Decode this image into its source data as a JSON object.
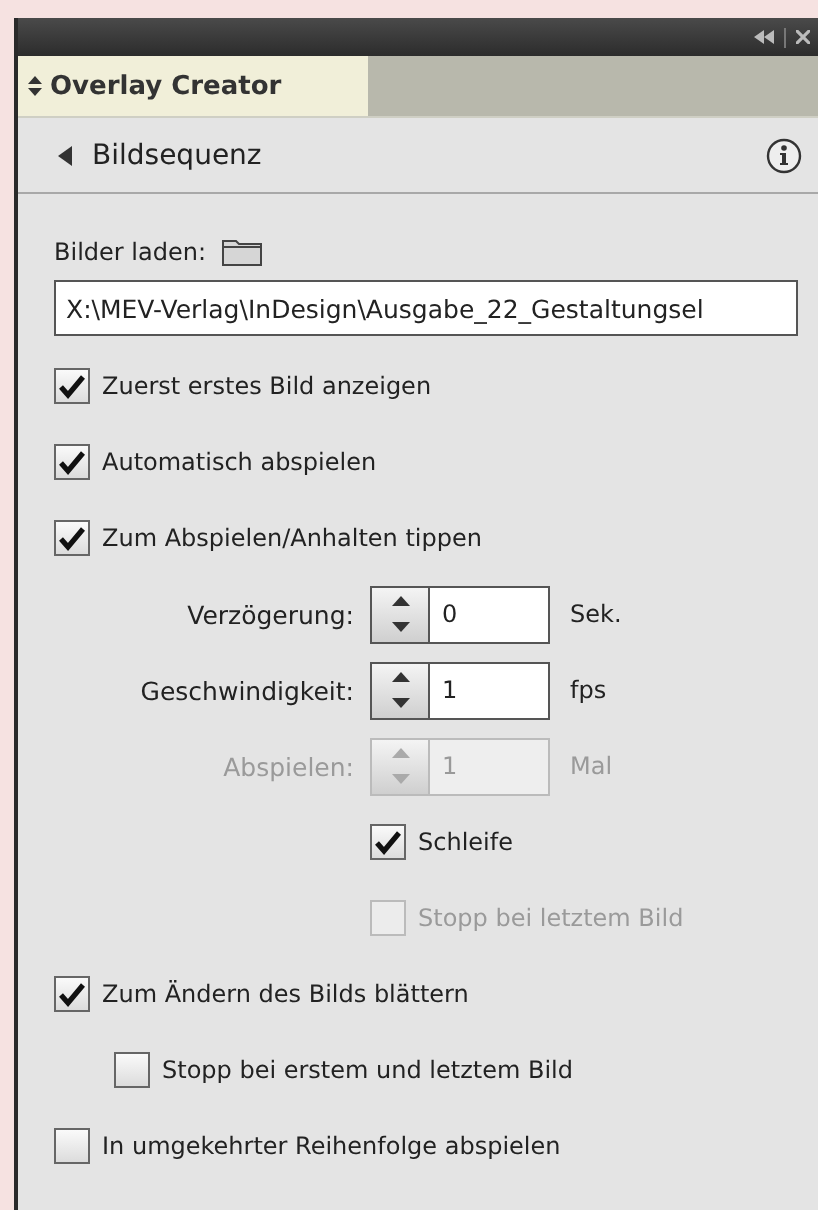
{
  "panel": {
    "tab": {
      "label": "Overlay Creator",
      "selected": true
    },
    "header": {
      "title": "Bildsequenz"
    },
    "source": {
      "label": "Bilder laden:",
      "path": "X:\\MEV-Verlag\\InDesign\\Ausgabe_22_Gestaltungsel"
    },
    "options": [
      {
        "kind": "checkbox",
        "label": "Zuerst erstes Bild anzeigen",
        "checked": true,
        "disabled": false
      },
      {
        "kind": "checkbox",
        "label": "Automatisch abspielen",
        "checked": true,
        "disabled": false
      },
      {
        "kind": "checkbox",
        "label": "Zum Abspielen/Anhalten tippen",
        "checked": true,
        "disabled": false,
        "children": [
          {
            "kind": "spinner",
            "label": "Verzögerung:",
            "value": "0",
            "unit": "Sek.",
            "disabled": false
          },
          {
            "kind": "spinner",
            "label": "Geschwindigkeit:",
            "value": "1",
            "unit": "fps",
            "disabled": false
          },
          {
            "kind": "spinner",
            "label": "Abspielen:",
            "value": "1",
            "unit": "Mal",
            "disabled": true
          },
          {
            "kind": "checkbox",
            "label": "Schleife",
            "checked": true,
            "disabled": false
          },
          {
            "kind": "checkbox",
            "label": "Stopp bei letztem Bild",
            "checked": false,
            "disabled": true
          }
        ]
      },
      {
        "kind": "checkbox",
        "label": "Zum Ändern des Bilds blättern",
        "checked": true,
        "disabled": false,
        "children": [
          {
            "kind": "checkbox",
            "label": "Stopp bei erstem und letztem Bild",
            "checked": false,
            "disabled": false
          }
        ]
      },
      {
        "kind": "checkbox",
        "label": "In umgekehrter Reihenfolge abspielen",
        "checked": false,
        "disabled": false
      }
    ]
  }
}
